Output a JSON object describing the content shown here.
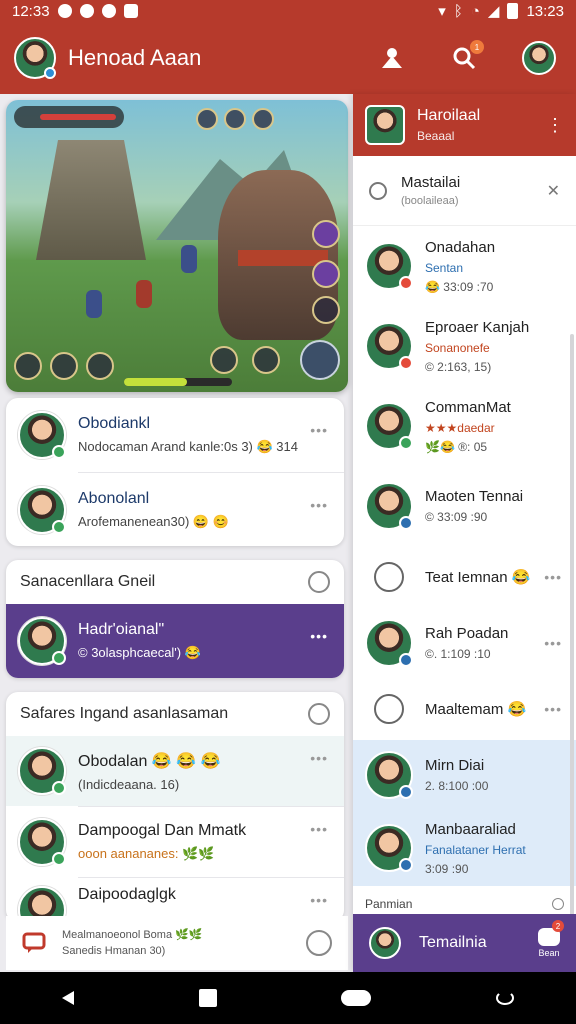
{
  "status_bar": {
    "time_left": "12:33",
    "time_right": "13:23"
  },
  "app_bar": {
    "title": "Henoad Aaan",
    "notification_badge": "1"
  },
  "game": {},
  "featured": [
    {
      "name": "Obodiankl",
      "sub": "Nodocaman Arand kanle:0s 3) 😂 314"
    },
    {
      "name": "Abonolanl",
      "sub": "Arofemanenean30) 😄 😊"
    }
  ],
  "section1": {
    "title": "Sanacenllara Gneil",
    "selected": {
      "name": "Hadr'oianal\"",
      "sub": "© 3olasphcaecal') 😂"
    }
  },
  "section2": {
    "title": "Safares Ingand asanlasaman",
    "rows": [
      {
        "name": "Obodalan 😂 😂 😂",
        "sub": "(Indicdeaana. 16)",
        "style": ""
      },
      {
        "name": "Dampoogal Dan Mmatk",
        "sub": "ooon aanananes: 🌿🌿",
        "style": "accent"
      },
      {
        "name": "Daipoodaglgk",
        "sub": "",
        "style": ""
      }
    ]
  },
  "bottom_strip": {
    "line1": "Mealmanoeonol Boma 🌿🌿",
    "line2": "Sanedis Hmanan 30)"
  },
  "right_panel": {
    "header": {
      "title": "Haroilaal",
      "subtitle": "Beaaal"
    },
    "search": {
      "title": "Mastailai",
      "subtitle": "(boolaileaa)"
    },
    "rows": [
      {
        "name": "Onadahan",
        "sub": "Sentan",
        "sub2": "😂 33:09 :70",
        "style": "blue"
      },
      {
        "name": "Eproaer Kanjah",
        "sub": "Sonanonefe",
        "sub2": "© 2:163, 15)",
        "style": "red"
      },
      {
        "name": "CommanMat",
        "sub": "★★★daedar",
        "sub2": "🌿😂 ®: 05",
        "style": "red"
      },
      {
        "name": "Maoten Tennai",
        "sub": "© 33:09 :90",
        "sub2": "",
        "style": ""
      }
    ],
    "glyph_rows": [
      {
        "name": "Teat Iemnan 😂"
      },
      {
        "name": "Maaltemam 😂"
      }
    ],
    "row_rah": {
      "name": "Rah Poadan",
      "sub": "©. 1:109 :10"
    },
    "highlight_rows": [
      {
        "name": "Mirn Diai",
        "sub": "2. 8:100 :00"
      },
      {
        "name": "Manbaaraliad",
        "sub": "Fanalataner Herrat",
        "sub2": "3:09 :90"
      }
    ],
    "footer_label": "Panmian",
    "bottom": {
      "label": "Temailnia",
      "action_label": "Bean",
      "action_count": "2"
    }
  }
}
